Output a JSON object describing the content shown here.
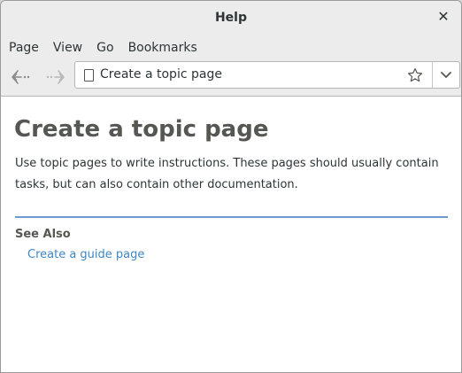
{
  "window": {
    "title": "Help",
    "close_icon": "close-icon"
  },
  "menubar": {
    "items": [
      "Page",
      "View",
      "Go",
      "Bookmarks"
    ]
  },
  "toolbar": {
    "back_icon": "back-arrow-icon",
    "forward_icon": "forward-arrow-icon",
    "location_text": "Create a topic page",
    "page_icon": "page-icon",
    "bookmark_icon": "star-icon",
    "dropdown_icon": "chevron-down-icon"
  },
  "content": {
    "title": "Create a topic page",
    "body": "Use topic pages to write instructions. These pages should usually contain tasks, but can also contain other documentation.",
    "see_also_heading": "See Also",
    "see_also_links": [
      "Create a guide page"
    ]
  },
  "colors": {
    "heading": "#555753",
    "link": "#3e86c6",
    "rule": "#6c9bcf"
  }
}
